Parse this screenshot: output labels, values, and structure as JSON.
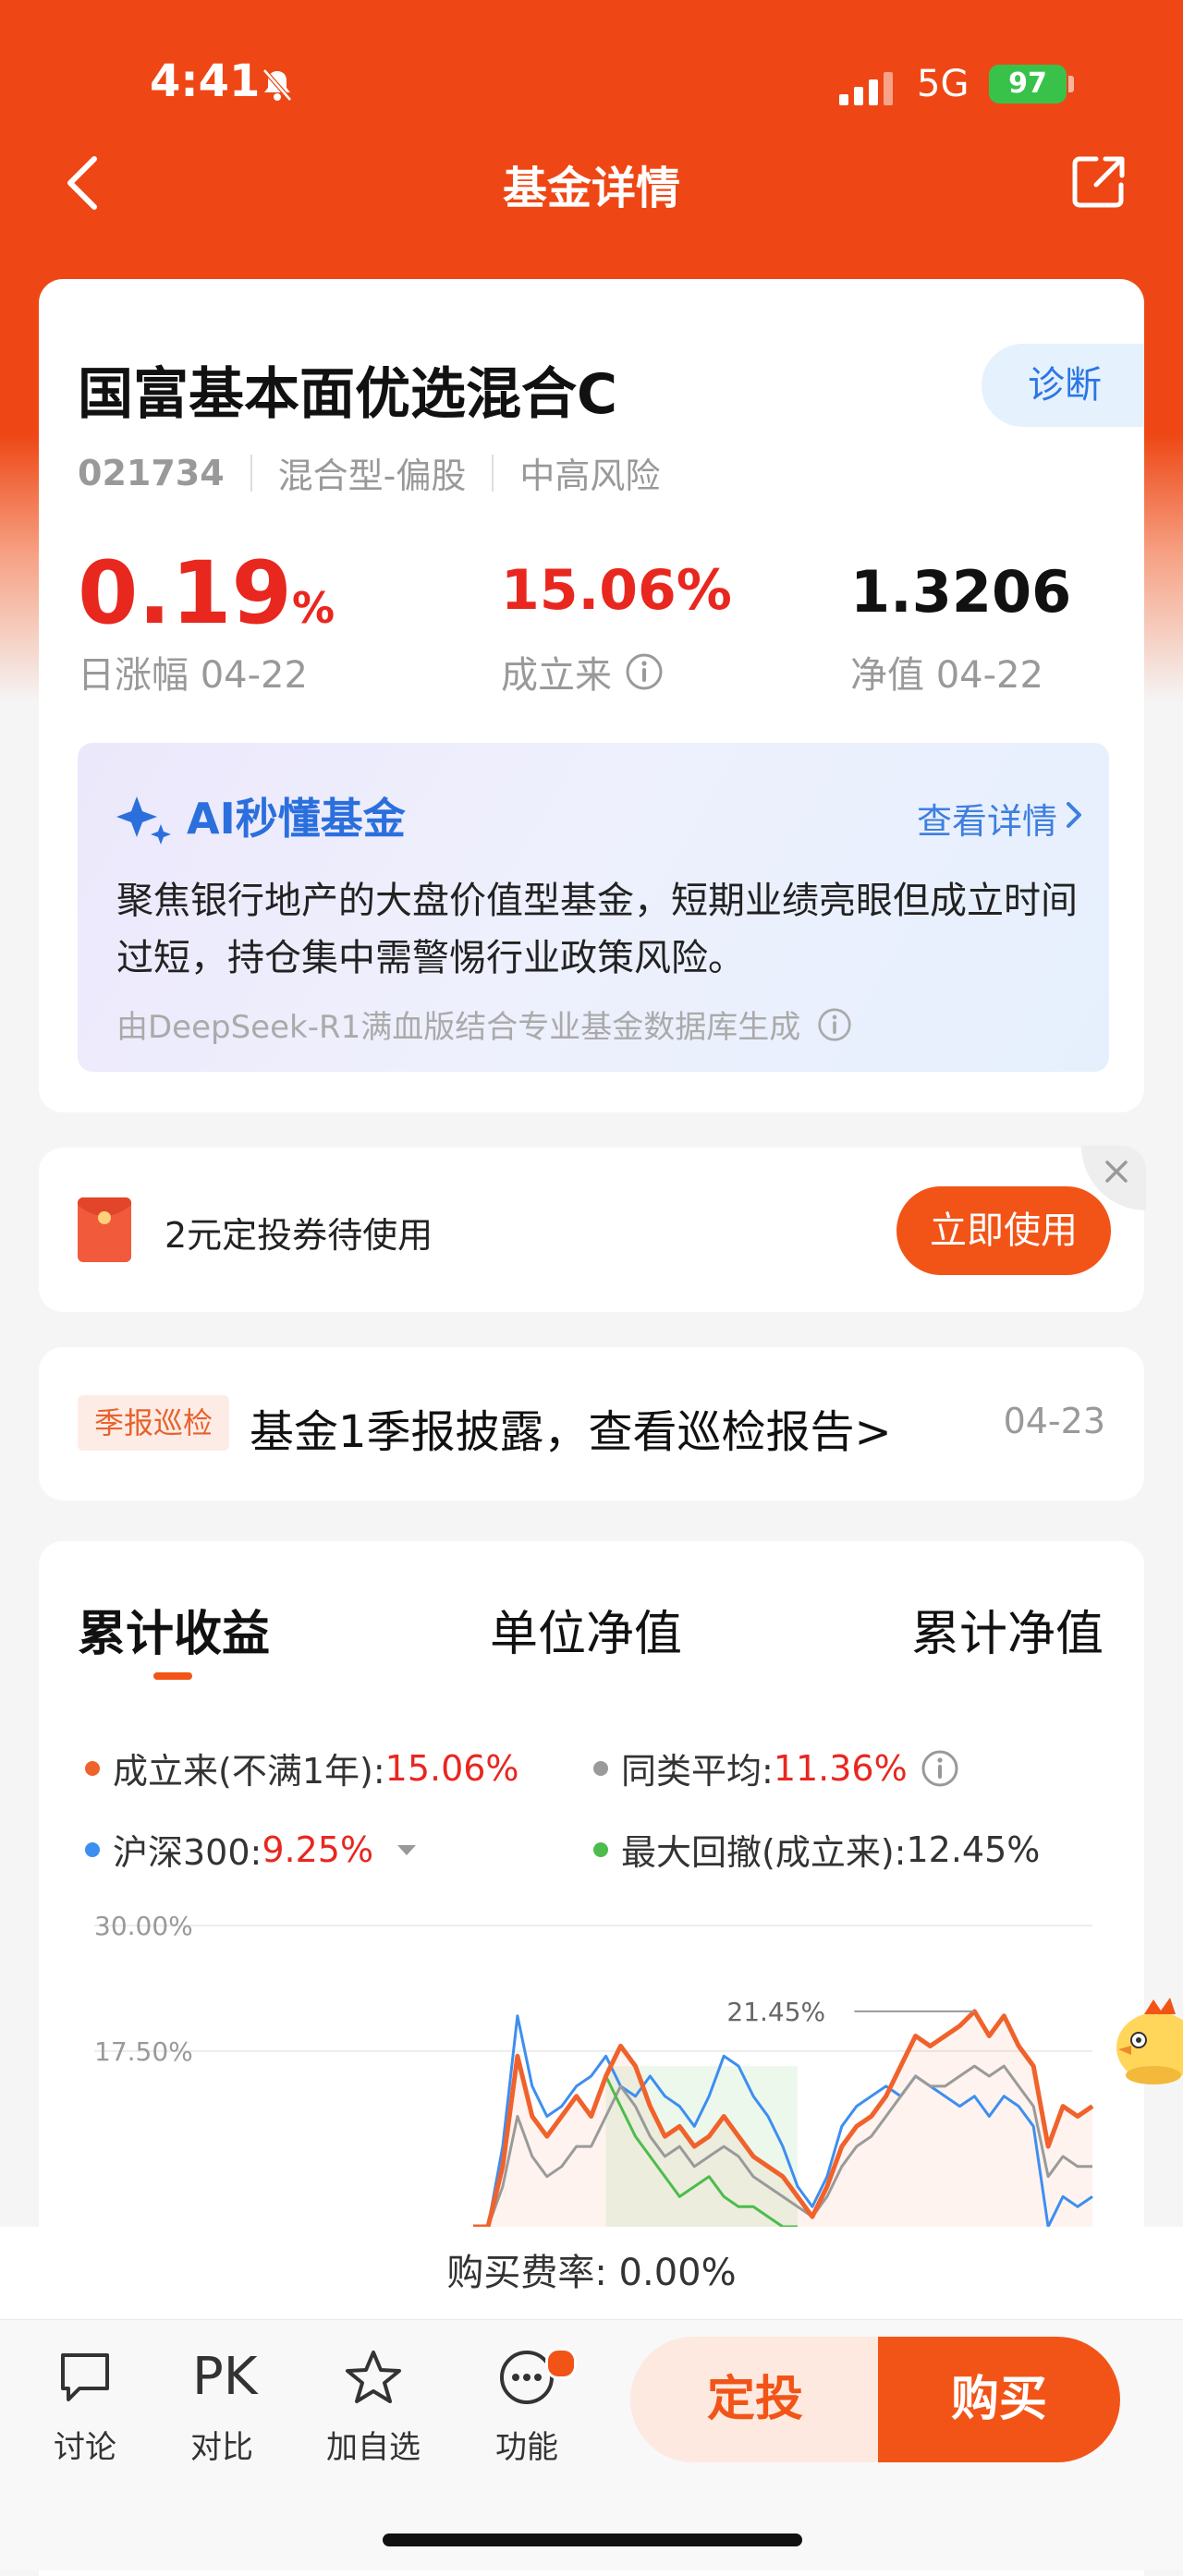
{
  "status": {
    "time": "4:41",
    "network": "5G",
    "battery": "97"
  },
  "nav": {
    "title": "基金详情"
  },
  "fund": {
    "name": "国富基本面优选混合C",
    "diagnose": "诊断",
    "code": "021734",
    "type": "混合型-偏股",
    "risk": "中高风险",
    "daily_change": "0.19",
    "daily_change_unit": "%",
    "daily_label": "日涨幅 04-22",
    "since_inception": "15.06%",
    "since_label": "成立来",
    "nav_value": "1.3206",
    "nav_label": "净值 04-22"
  },
  "ai": {
    "title": "AI秒懂基金",
    "detail": "查看详情",
    "text": "聚焦银行地产的大盘价值型基金，短期业绩亮眼但成立时间过短，持仓集中需警惕行业政策风险。",
    "footer": "由DeepSeek-R1满血版结合专业基金数据库生成"
  },
  "coupon": {
    "text": "2元定投券待使用",
    "button": "立即使用"
  },
  "report": {
    "tag": "季报巡检",
    "text": "基金1季报披露，查看巡检报告>",
    "date": "04-23"
  },
  "tabs": [
    "累计收益",
    "单位净值",
    "累计净值"
  ],
  "legend": {
    "since_label": "成立来(不满1年):",
    "since_value": "15.06%",
    "peer_label": "同类平均:",
    "peer_value": "11.36%",
    "hs300_label": "沪深300:",
    "hs300_value": "9.25%",
    "drawdown_label": "最大回撤(成立来):",
    "drawdown_value": "12.45%"
  },
  "colors": {
    "accent": "#f25418",
    "up": "#e8271f",
    "fund": "#f0622c",
    "peer": "#9a9a9a",
    "hs300": "#3d8ef0",
    "drawdown": "#4cbc4c"
  },
  "chart_data": {
    "type": "line",
    "ylim": [
      0,
      30
    ],
    "ytick_labels": [
      "30.00%",
      "17.50%"
    ],
    "peak_annotation": "21.45%",
    "series": [
      {
        "name": "成立来(不满1年)",
        "values": [
          0,
          0,
          6,
          17,
          11,
          9,
          11,
          13,
          11,
          15,
          18,
          16,
          12,
          9,
          10,
          8,
          9,
          11,
          9,
          7,
          6,
          5,
          3,
          1,
          4,
          8,
          10,
          11,
          13,
          16,
          19,
          18,
          19,
          20,
          21.45,
          19,
          21,
          18,
          16,
          8,
          12,
          11,
          12
        ]
      },
      {
        "name": "同类平均",
        "values": [
          0,
          0,
          4,
          11,
          7,
          5,
          6,
          8,
          8,
          11,
          14,
          12,
          9,
          7,
          8,
          6,
          7,
          8,
          7,
          5,
          4,
          3,
          2,
          1,
          3,
          6,
          8,
          9,
          11,
          13,
          15,
          14,
          14,
          15,
          16,
          15,
          16,
          14,
          12,
          5,
          7,
          6,
          6
        ]
      },
      {
        "name": "沪深300",
        "values": [
          0,
          0,
          8,
          21,
          14,
          11,
          12,
          14,
          15,
          17,
          14,
          13,
          15,
          13,
          12,
          10,
          13,
          17,
          16,
          13,
          11,
          8,
          4,
          2,
          5,
          10,
          12,
          13,
          14,
          13,
          15,
          14,
          13,
          12,
          13,
          11,
          13,
          12,
          10,
          0,
          3,
          2,
          3
        ]
      },
      {
        "name": "最大回撤(成立来)",
        "values": [
          null,
          null,
          null,
          null,
          null,
          null,
          null,
          null,
          null,
          15,
          12,
          9,
          7,
          5,
          3,
          4,
          5,
          3,
          2,
          2,
          1,
          0,
          0
        ]
      }
    ]
  }
}
